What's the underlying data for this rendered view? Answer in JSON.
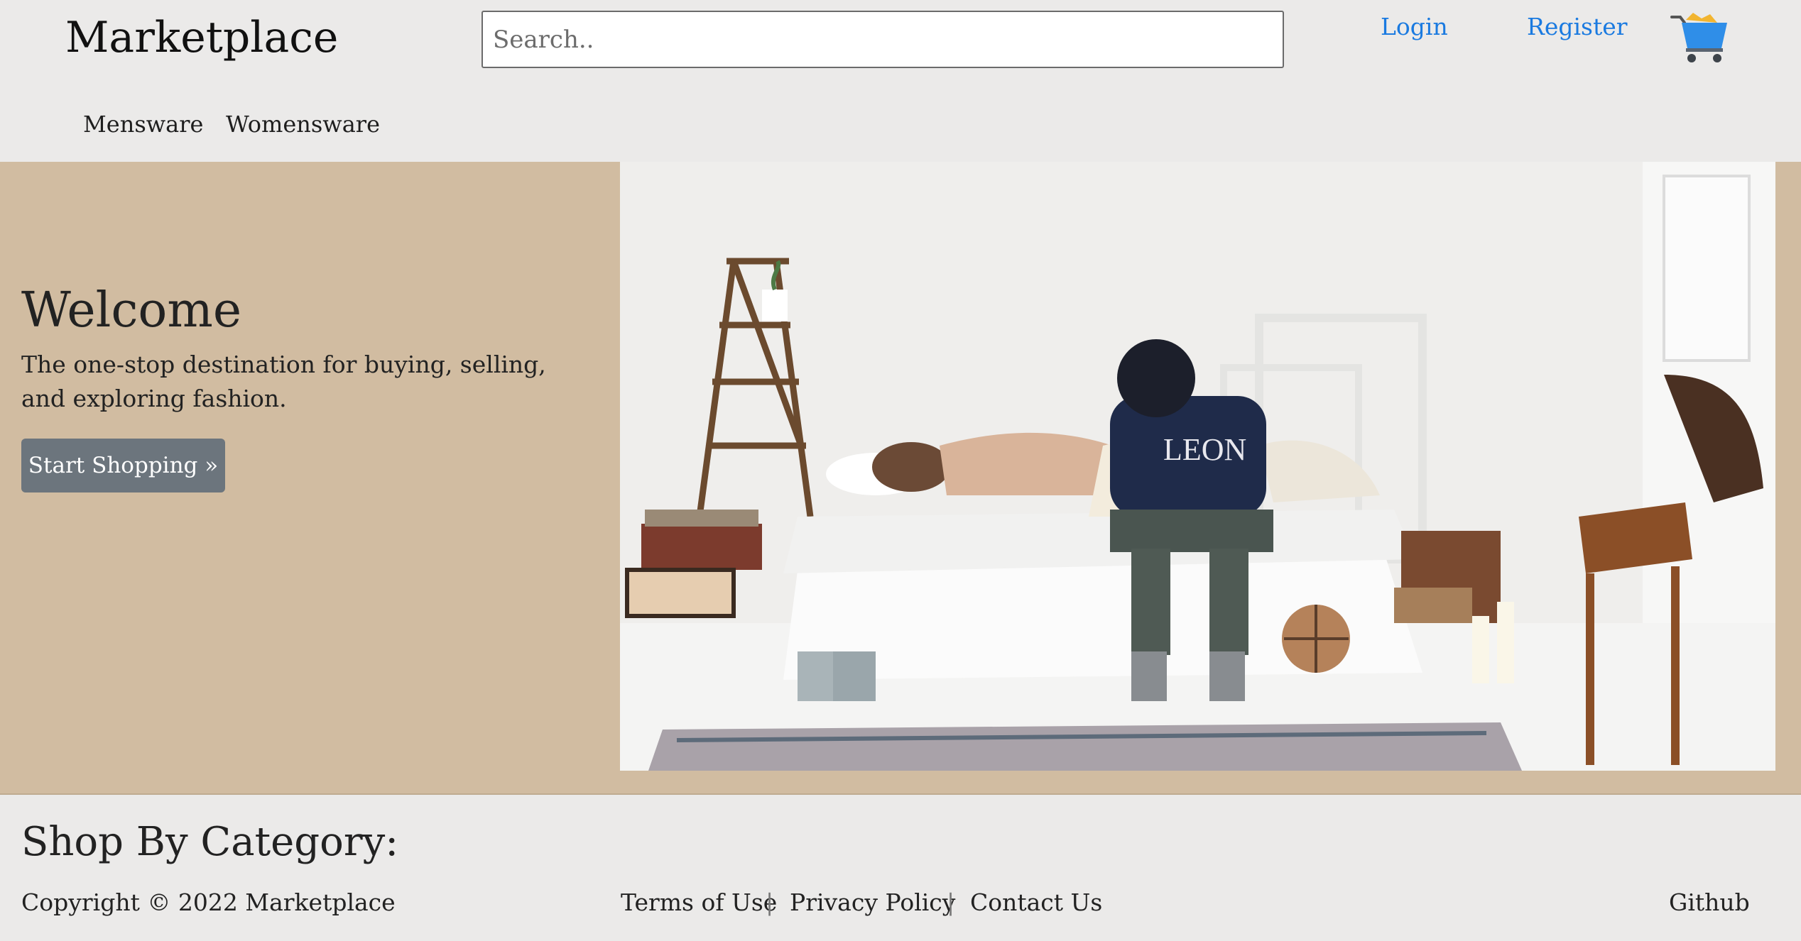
{
  "header": {
    "brand": "Marketplace",
    "search_placeholder": "Search..",
    "login": "Login",
    "register": "Register",
    "categories": [
      "Mensware",
      "Womensware"
    ]
  },
  "hero": {
    "title": "Welcome",
    "tagline": "The one-stop destination for buying, selling, and exploring fashion.",
    "cta": "Start Shopping »",
    "image_text": "LEON"
  },
  "category_section": {
    "title": "Shop By Category:"
  },
  "footer": {
    "copyright": "Copyright © 2022 Marketplace",
    "links": [
      "Terms of Use",
      "Privacy Policy",
      "Contact Us"
    ],
    "separator": "|",
    "github": "Github"
  },
  "colors": {
    "header_bg": "#ebeae9",
    "hero_bg": "#d1bca1",
    "link": "#1a7ae0",
    "button": "#6c757d"
  },
  "icons": {
    "cart": "shopping-cart-icon"
  }
}
